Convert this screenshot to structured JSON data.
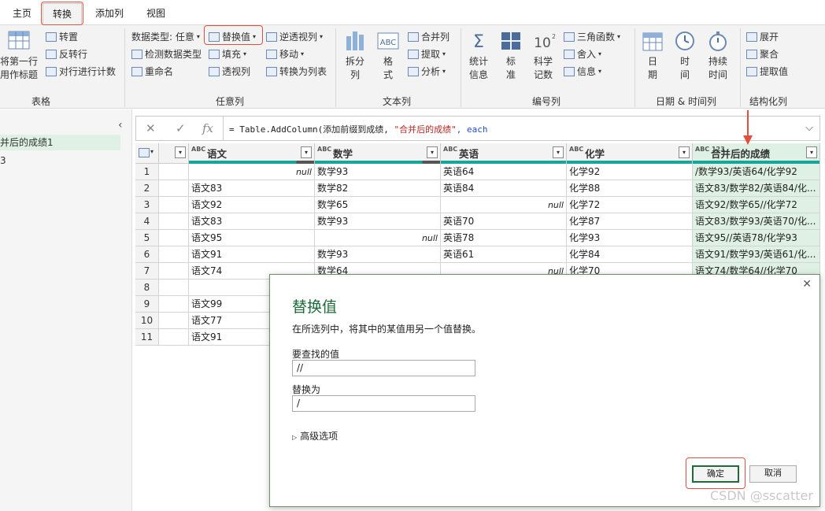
{
  "tabs": [
    "主页",
    "转换",
    "添加列",
    "视图"
  ],
  "ribbon": {
    "table_group": {
      "label": "表格",
      "use_first_row_1": "将第一行",
      "use_first_row_2": "用作标题",
      "transpose": "转置",
      "reverse_rows": "反转行",
      "count_rows": "对行进行计数"
    },
    "any_col": {
      "label": "任意列",
      "data_type": "数据类型: 任意",
      "detect": "检测数据类型",
      "rename": "重命名",
      "replace": "替换值",
      "fill": "填充",
      "pivot": "透视列",
      "unpivot": "逆透视列",
      "move": "移动",
      "to_list": "转换为列表"
    },
    "text_col": {
      "label": "文本列",
      "split_1": "拆分",
      "split_2": "列",
      "format_1": "格",
      "format_2": "式",
      "merge": "合并列",
      "extract": "提取",
      "parse": "分析"
    },
    "number_col": {
      "label": "编号列",
      "stats_1": "统计",
      "stats_2": "信息",
      "std_1": "标",
      "std_2": "准",
      "sci_1": "科学",
      "sci_2": "记数",
      "trig": "三角函数",
      "round": "舍入",
      "info": "信息"
    },
    "datetime_col": {
      "label": "日期 & 时间列",
      "date_1": "日",
      "date_2": "期",
      "time_1": "时",
      "time_2": "间",
      "dur_1": "持续",
      "dur_2": "时间"
    },
    "struct_col": {
      "label": "结构化列",
      "expand": "展开",
      "aggregate": "聚合",
      "extract_values": "提取值"
    }
  },
  "queries": [
    "并后的成绩1",
    "3"
  ],
  "formula": {
    "fx": "fx",
    "prefix": "= Table.AddColumn(添加前缀到成绩, ",
    "str": "\"合并后的成绩\"",
    "suffix": ", each"
  },
  "columns": [
    "语文",
    "数学",
    "英语",
    "化学",
    "合并后的成绩"
  ],
  "type_labels": [
    "ABC",
    "ABC",
    "ABC",
    "ABC",
    "ABC 123"
  ],
  "rows": [
    {
      "n": "1",
      "c": [
        "null",
        "数学93",
        "英语64",
        "化学92",
        "/数学93/英语64/化学92"
      ]
    },
    {
      "n": "2",
      "c": [
        "语文83",
        "数学82",
        "英语84",
        "化学88",
        "语文83/数学82/英语84/化..."
      ]
    },
    {
      "n": "3",
      "c": [
        "语文92",
        "数学65",
        "null",
        "化学72",
        "语文92/数学65//化学72"
      ]
    },
    {
      "n": "4",
      "c": [
        "语文83",
        "数学93",
        "英语70",
        "化学87",
        "语文83/数学93/英语70/化..."
      ]
    },
    {
      "n": "5",
      "c": [
        "语文95",
        "null",
        "英语78",
        "化学93",
        "语文95//英语78/化学93"
      ]
    },
    {
      "n": "6",
      "c": [
        "语文91",
        "数学93",
        "英语61",
        "化学84",
        "语文91/数学93/英语61/化..."
      ]
    },
    {
      "n": "7",
      "c": [
        "语文74",
        "数学64",
        "null",
        "化学70",
        "语文74/数学64//化学70"
      ]
    },
    {
      "n": "8",
      "c": [
        "",
        "",
        "",
        "",
        ""
      ]
    },
    {
      "n": "9",
      "c": [
        "语文99",
        "",
        "",
        "",
        ""
      ]
    },
    {
      "n": "10",
      "c": [
        "语文77",
        "",
        "",
        "",
        ""
      ]
    },
    {
      "n": "11",
      "c": [
        "语文91",
        "",
        "",
        "",
        ""
      ]
    }
  ],
  "dialog": {
    "title": "替换值",
    "desc": "在所选列中，将其中的某值用另一个值替换。",
    "find_label": "要查找的值",
    "find_value": "//",
    "replace_label": "替换为",
    "replace_value": "/",
    "advanced": "高级选项",
    "ok": "确定",
    "cancel": "取消",
    "close": "✕"
  },
  "watermark": "CSDN @sscatter",
  "colors": {
    "accent": "#17a79a",
    "highlight": "#e0503c",
    "dialog_title": "#1d6a3a"
  }
}
